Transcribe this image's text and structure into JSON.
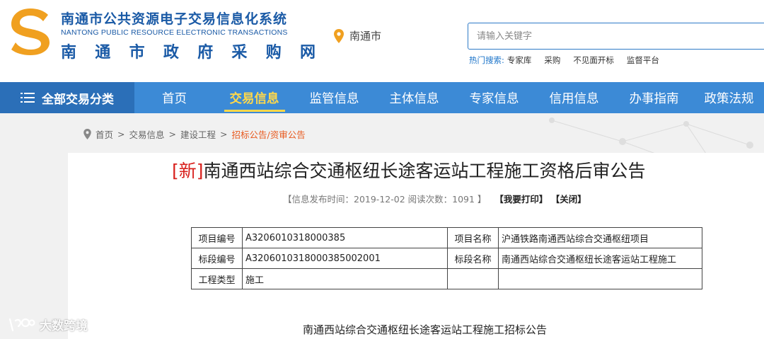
{
  "header": {
    "title_cn": "南通市公共资源电子交易信息化系统",
    "title_en": "NANTONG PUBLIC RESOURCE ELECTRONIC TRANSACTIONS",
    "subtitle_chars": [
      "南",
      "通",
      "市",
      "政",
      "府",
      "采",
      "购",
      "网"
    ],
    "location": "南通市",
    "search_placeholder": "请输入关键字",
    "hot_label": "热门搜索:",
    "hot_items": [
      "专家库",
      "采购",
      "不见面开标",
      "监督平台"
    ]
  },
  "nav": {
    "all_label": "全部交易分类",
    "items": [
      {
        "label": "首页",
        "active": false
      },
      {
        "label": "交易信息",
        "active": true
      },
      {
        "label": "监管信息",
        "active": false
      },
      {
        "label": "主体信息",
        "active": false
      },
      {
        "label": "专家信息",
        "active": false
      },
      {
        "label": "信用信息",
        "active": false
      },
      {
        "label": "办事指南",
        "active": false
      },
      {
        "label": "政策法规",
        "active": false
      }
    ]
  },
  "breadcrumb": {
    "items": [
      "首页",
      "交易信息",
      "建设工程"
    ],
    "separator": ">",
    "current": "招标公告/资审公告"
  },
  "article": {
    "new_tag": "[新]",
    "title": "南通西站综合交通枢纽长途客运站工程施工资格后审公告",
    "meta_info": "【信息发布时间：2019-12-02 阅读次数：1091 】",
    "print_label": "【我要打印】",
    "close_label": "【关闭】",
    "table": [
      [
        "项目编号",
        "A3206010318000385",
        "项目名称",
        "沪通铁路南通西站综合交通枢纽项目"
      ],
      [
        "标段编号",
        "A3206010318000385002001",
        "标段名称",
        "南通西站综合交通枢纽长途客运站工程施工"
      ],
      [
        "工程类型",
        "施工",
        "",
        ""
      ]
    ],
    "section_heading": "南通西站综合交通枢纽长途客运站工程施工招标公告"
  },
  "watermark": {
    "text": "大数跨境"
  },
  "colors": {
    "brand_blue": "#1a5aa6",
    "nav_bg": "#3c8ad6",
    "nav_all_bg": "#2b6fb8",
    "nav_active": "#ffd84a",
    "logo_gold": "#f0a020",
    "breadcrumb_current": "#e85a20",
    "new_tag": "#d8201c"
  }
}
